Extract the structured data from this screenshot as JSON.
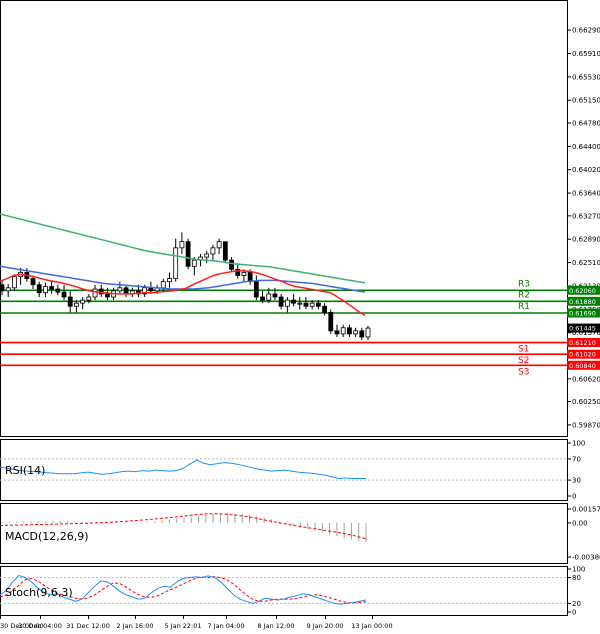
{
  "chart_data": {
    "type": "candlestick",
    "price_panel": {
      "y_ticks": [
        "0.66290",
        "0.65910",
        "0.65530",
        "0.65150",
        "0.64780",
        "0.64400",
        "0.64020",
        "0.63640",
        "0.63270",
        "0.62890",
        "0.62510",
        "0.62130",
        "0.61750",
        "0.61370",
        "0.61000",
        "0.60620",
        "0.60250",
        "0.59870"
      ],
      "ylim": [
        0.5982,
        0.6665
      ],
      "candles": [
        [
          0.6215,
          0.6223,
          0.6198,
          0.6205
        ],
        [
          0.6205,
          0.6216,
          0.6195,
          0.621
        ],
        [
          0.621,
          0.6232,
          0.6205,
          0.6228
        ],
        [
          0.6228,
          0.6242,
          0.6215,
          0.6235
        ],
        [
          0.6235,
          0.6242,
          0.622,
          0.6225
        ],
        [
          0.6225,
          0.623,
          0.6208,
          0.6215
        ],
        [
          0.6215,
          0.622,
          0.6195,
          0.6202
        ],
        [
          0.6202,
          0.6218,
          0.6195,
          0.6212
        ],
        [
          0.6212,
          0.622,
          0.62,
          0.6208
        ],
        [
          0.6208,
          0.6215,
          0.6198,
          0.6203
        ],
        [
          0.6203,
          0.6215,
          0.619,
          0.6195
        ],
        [
          0.6195,
          0.6205,
          0.617,
          0.618
        ],
        [
          0.618,
          0.619,
          0.617,
          0.6185
        ],
        [
          0.6185,
          0.6195,
          0.6175,
          0.619
        ],
        [
          0.619,
          0.62,
          0.6185,
          0.6195
        ],
        [
          0.6195,
          0.6215,
          0.619,
          0.6208
        ],
        [
          0.6208,
          0.6215,
          0.6195,
          0.62
        ],
        [
          0.62,
          0.621,
          0.619,
          0.6195
        ],
        [
          0.6195,
          0.621,
          0.619,
          0.6205
        ],
        [
          0.6205,
          0.622,
          0.62,
          0.621
        ],
        [
          0.621,
          0.6215,
          0.6195,
          0.62
        ],
        [
          0.62,
          0.621,
          0.6195,
          0.6205
        ],
        [
          0.6205,
          0.6215,
          0.6195,
          0.62
        ],
        [
          0.62,
          0.6215,
          0.6195,
          0.621
        ],
        [
          0.621,
          0.622,
          0.62,
          0.6205
        ],
        [
          0.6205,
          0.6215,
          0.62,
          0.621
        ],
        [
          0.621,
          0.6225,
          0.6205,
          0.622
        ],
        [
          0.622,
          0.6235,
          0.621,
          0.6225
        ],
        [
          0.6225,
          0.629,
          0.622,
          0.6275
        ],
        [
          0.6275,
          0.63,
          0.6265,
          0.6285
        ],
        [
          0.6285,
          0.629,
          0.624,
          0.6245
        ],
        [
          0.6245,
          0.626,
          0.623,
          0.6255
        ],
        [
          0.6255,
          0.6265,
          0.6245,
          0.626
        ],
        [
          0.626,
          0.627,
          0.625,
          0.6265
        ],
        [
          0.6265,
          0.628,
          0.6255,
          0.6275
        ],
        [
          0.6275,
          0.629,
          0.6265,
          0.6285
        ],
        [
          0.6285,
          0.6285,
          0.625,
          0.6255
        ],
        [
          0.6255,
          0.626,
          0.6235,
          0.624
        ],
        [
          0.624,
          0.625,
          0.6225,
          0.623
        ],
        [
          0.623,
          0.624,
          0.622,
          0.6235
        ],
        [
          0.6235,
          0.624,
          0.6215,
          0.622
        ],
        [
          0.622,
          0.623,
          0.619,
          0.6195
        ],
        [
          0.6195,
          0.6205,
          0.6185,
          0.619
        ],
        [
          0.619,
          0.621,
          0.6185,
          0.62
        ],
        [
          0.62,
          0.621,
          0.619,
          0.6195
        ],
        [
          0.6195,
          0.62,
          0.6175,
          0.618
        ],
        [
          0.618,
          0.6195,
          0.617,
          0.619
        ],
        [
          0.619,
          0.62,
          0.618,
          0.6185
        ],
        [
          0.6185,
          0.6195,
          0.6175,
          0.6185
        ],
        [
          0.6185,
          0.6195,
          0.6175,
          0.618
        ],
        [
          0.618,
          0.619,
          0.6175,
          0.6185
        ],
        [
          0.6185,
          0.619,
          0.6175,
          0.618
        ],
        [
          0.618,
          0.6185,
          0.6165,
          0.617
        ],
        [
          0.617,
          0.6175,
          0.6135,
          0.614
        ],
        [
          0.614,
          0.615,
          0.613,
          0.6135
        ],
        [
          0.6135,
          0.615,
          0.613,
          0.6145
        ],
        [
          0.6145,
          0.615,
          0.613,
          0.6135
        ],
        [
          0.6135,
          0.6145,
          0.613,
          0.614
        ],
        [
          0.614,
          0.6145,
          0.6125,
          0.613
        ],
        [
          0.613,
          0.6148,
          0.6125,
          0.61445
        ]
      ],
      "ma_green": [
        0.633,
        0.6327,
        0.6324,
        0.6321,
        0.6318,
        0.6315,
        0.6312,
        0.6309,
        0.6306,
        0.6303,
        0.63,
        0.6297,
        0.6294,
        0.6291,
        0.6288,
        0.6285,
        0.6282,
        0.6279,
        0.6276,
        0.6273,
        0.627,
        0.6268,
        0.6266,
        0.6264,
        0.6262,
        0.626,
        0.6258,
        0.6256,
        0.6255,
        0.6254,
        0.6253,
        0.6251,
        0.6249,
        0.6248,
        0.6247,
        0.6246,
        0.6245,
        0.6244,
        0.6242,
        0.624,
        0.6238,
        0.6236,
        0.6234,
        0.6232,
        0.623,
        0.6228,
        0.6226,
        0.6224,
        0.6222,
        0.622,
        0.6218
      ],
      "ma_blue": [
        0.6245,
        0.6243,
        0.6241,
        0.6239,
        0.6237,
        0.6235,
        0.6233,
        0.6231,
        0.6229,
        0.6227,
        0.6225,
        0.6223,
        0.6221,
        0.6219,
        0.6217,
        0.6216,
        0.6215,
        0.6214,
        0.6213,
        0.6212,
        0.6211,
        0.621,
        0.6209,
        0.6208,
        0.6208,
        0.6208,
        0.6208,
        0.6209,
        0.621,
        0.6212,
        0.6214,
        0.6216,
        0.6218,
        0.622,
        0.6221,
        0.6222,
        0.6222,
        0.6222,
        0.6221,
        0.622,
        0.6219,
        0.6218,
        0.6217,
        0.6215,
        0.6213,
        0.6211,
        0.6209,
        0.6207,
        0.6205,
        0.6203
      ],
      "ma_red": [
        0.622,
        0.6225,
        0.623,
        0.6232,
        0.623,
        0.6228,
        0.6225,
        0.6222,
        0.622,
        0.6218,
        0.6215,
        0.6212,
        0.6208,
        0.6205,
        0.6203,
        0.6202,
        0.6201,
        0.62,
        0.62,
        0.62,
        0.6201,
        0.6202,
        0.6202,
        0.6203,
        0.6204,
        0.6205,
        0.6207,
        0.6209,
        0.6215,
        0.622,
        0.6225,
        0.623,
        0.6233,
        0.6235,
        0.6237,
        0.6238,
        0.6237,
        0.6235,
        0.6232,
        0.6228,
        0.6224,
        0.622,
        0.6215,
        0.6212,
        0.621,
        0.6208,
        0.6206,
        0.6204,
        0.6202,
        0.6195,
        0.6188,
        0.618,
        0.6172,
        0.6165
      ],
      "levels": [
        {
          "label": "R3",
          "value": 0.6206,
          "value_text": "0.62060",
          "color": "#008000"
        },
        {
          "label": "R2",
          "value": 0.6188,
          "value_text": "0.61880",
          "color": "#008000"
        },
        {
          "label": "R1",
          "value": 0.6169,
          "value_text": "0.61690",
          "color": "#008000"
        },
        {
          "label": "S1",
          "value": 0.6121,
          "value_text": "0.61210",
          "color": "#ff0000"
        },
        {
          "label": "S2",
          "value": 0.6102,
          "value_text": "0.61020",
          "color": "#ff0000"
        },
        {
          "label": "S3",
          "value": 0.6084,
          "value_text": "0.60840",
          "color": "#ff0000"
        }
      ],
      "current_price": {
        "value": 0.61445,
        "text": "0.61445"
      }
    },
    "rsi_panel": {
      "label": "RSI(14)",
      "levels": [
        "100",
        "70",
        "30",
        "0"
      ],
      "values": [
        55,
        52,
        50,
        48,
        47,
        46,
        45,
        44,
        43,
        42,
        42,
        42,
        44,
        45,
        43,
        41,
        42,
        44,
        46,
        47,
        46,
        48,
        47,
        49,
        48,
        47,
        48,
        52,
        60,
        68,
        62,
        59,
        61,
        63,
        62,
        60,
        57,
        54,
        51,
        49,
        47,
        48,
        49,
        47,
        45,
        44,
        43,
        41,
        39,
        36,
        33,
        34,
        33,
        33,
        33
      ],
      "color": "#1e90ff"
    },
    "macd_panel": {
      "label": "MACD(12,26,9)",
      "levels": [
        "0.00157",
        "0.00",
        "-0.003863"
      ],
      "ylim": [
        -0.003863,
        0.00157
      ],
      "histogram": [
        5e-05,
        0.0001,
        0.00012,
        0.00015,
        0.00018,
        0.0002,
        0.0002,
        0.00022,
        0.0002,
        0.00018,
        0.00015,
        0.00012,
        0.0001,
        8e-05,
        6e-05,
        5e-05,
        4e-05,
        5e-05,
        6e-05,
        0.0001,
        0.00014,
        0.0002,
        0.0003,
        0.0004,
        0.0005,
        0.0006,
        0.0007,
        0.0008,
        0.0009,
        0.001,
        0.00105,
        0.0011,
        0.00105,
        0.001,
        0.0009,
        0.0008,
        0.0006,
        0.0004,
        0.0002,
        -0.0001,
        -0.0003,
        -0.0005,
        -0.0007,
        -0.0009,
        -0.0011,
        -0.0013,
        -0.0015,
        -0.0017,
        -0.0019,
        -0.0021,
        -0.0022
      ],
      "signal": [
        -0.0003,
        -0.00028,
        -0.00026,
        -0.00024,
        -0.00022,
        -0.0002,
        -0.00018,
        -0.00016,
        -0.00014,
        -0.00012,
        -0.0001,
        -8e-05,
        -6e-05,
        -4e-05,
        -2e-05,
        2e-05,
        6e-05,
        0.0001,
        0.00015,
        0.0002,
        0.00026,
        0.00032,
        0.00038,
        0.00045,
        0.00052,
        0.0006,
        0.00068,
        0.00076,
        0.00085,
        0.00094,
        0.001,
        0.00103,
        0.00104,
        0.001,
        0.00094,
        0.00086,
        0.00076,
        0.00064,
        0.0005,
        0.00034,
        0.00018,
        4e-05,
        -0.0001,
        -0.00024,
        -0.00038,
        -0.0005,
        -0.00062,
        -0.00074,
        -0.00086,
        -0.00098,
        -0.0011,
        -0.00125,
        -0.0014,
        -0.0016,
        -0.0018
      ],
      "histogram_color": "#a0a0a0",
      "signal_color": "#ff0000"
    },
    "stoch_panel": {
      "label": "Stoch(9,6,3)",
      "levels": [
        "100",
        "80",
        "20",
        "0"
      ],
      "k": [
        40,
        50,
        70,
        85,
        80,
        70,
        55,
        45,
        40,
        42,
        35,
        30,
        25,
        30,
        45,
        60,
        72,
        70,
        60,
        48,
        40,
        35,
        30,
        32,
        45,
        55,
        60,
        58,
        70,
        78,
        80,
        82,
        80,
        84,
        80,
        70,
        55,
        40,
        30,
        25,
        20,
        25,
        32,
        30,
        28,
        30,
        35,
        38,
        42,
        40,
        35,
        30,
        25,
        20,
        18,
        20,
        22,
        25,
        28
      ],
      "d": [
        35,
        40,
        50,
        62,
        75,
        78,
        72,
        62,
        52,
        44,
        40,
        36,
        32,
        30,
        33,
        40,
        50,
        60,
        68,
        66,
        58,
        48,
        40,
        35,
        34,
        38,
        45,
        52,
        58,
        65,
        72,
        78,
        82,
        80,
        82,
        80,
        75,
        65,
        52,
        40,
        30,
        25,
        25,
        28,
        30,
        30,
        30,
        32,
        35,
        38,
        40,
        38,
        34,
        30,
        25,
        22,
        21,
        22,
        24
      ],
      "k_color": "#1e90ff",
      "d_color": "#ff0000"
    },
    "x_labels": [
      "30 Dec 00:00",
      "30 Dec 04:00",
      "31 Dec 12:00",
      "2 Jan 16:00",
      "5 Jan 22:01",
      "7 Jan 04:00",
      "8 Jan 12:00",
      "9 Jan 20:00",
      "13 Jan 00:00"
    ]
  }
}
